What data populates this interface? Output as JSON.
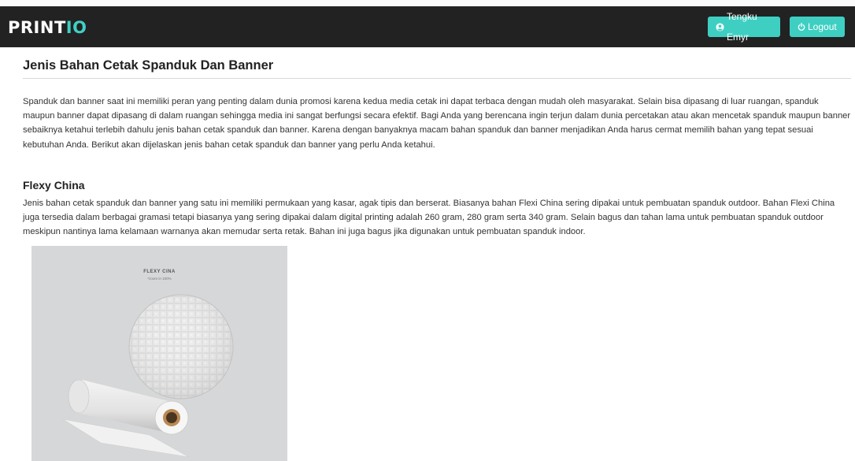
{
  "navbar": {
    "brand_main": "PRINT",
    "brand_accent": "IO",
    "user_button": "Tengku Emyr",
    "logout_button": "Logout"
  },
  "article": {
    "title": "Jenis Bahan Cetak Spanduk Dan Banner",
    "intro": "Spanduk dan banner saat ini memiliki peran yang penting dalam dunia promosi karena kedua media cetak ini dapat terbaca dengan mudah oleh masyarakat. Selain bisa dipasang di luar ruangan, spanduk maupun banner dapat dipasang di dalam ruangan sehingga media ini sangat berfungsi secara efektif. Bagi Anda yang berencana ingin terjun dalam dunia percetakan atau akan mencetak spanduk maupun banner sebaiknya ketahui terlebih dahulu jenis bahan cetak spanduk dan banner. Karena dengan banyaknya macam bahan spanduk dan banner menjadikan Anda harus cermat memilih bahan yang tepat sesuai kebutuhan Anda. Berikut akan dijelaskan jenis bahan cetak spanduk dan banner yang perlu Anda ketahui.",
    "sections": [
      {
        "heading": "Flexy China",
        "body": "Jenis bahan cetak spanduk dan banner yang satu ini memiliki permukaan yang kasar, agak tipis dan berserat. Biasanya bahan Flexi China sering dipakai untuk pembuatan spanduk outdoor. Bahan Flexi China juga tersedia dalam berbagai gramasi tetapi biasanya yang sering dipakai dalam digital printing adalah 260 gram, 280 gram serta 340 gram. Selain bagus dan tahan lama untuk pembuatan spanduk outdoor meskipun nantinya lama kelamaan warnanya akan memudar serta retak. Bahan ini juga bagus jika digunakan untuk pembuatan spanduk indoor.",
        "image_label": "FLEXY CINA",
        "image_sublabel": "*zoom in 100%"
      }
    ]
  },
  "colors": {
    "navbar_bg": "#222222",
    "accent": "#3ecfc2",
    "brand_accent": "#40d0c5"
  },
  "icons": {
    "user": "user-circle-icon",
    "logout": "power-icon"
  }
}
